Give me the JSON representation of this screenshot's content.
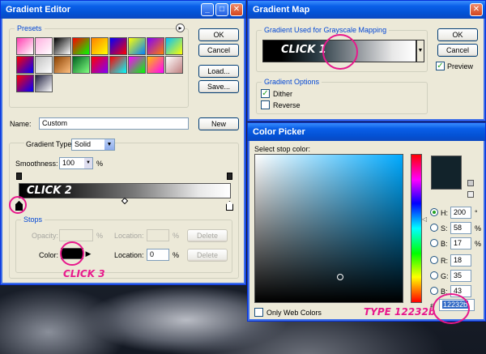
{
  "gradient_editor": {
    "title": "Gradient Editor",
    "presets_label": "Presets",
    "buttons": {
      "ok": "OK",
      "cancel": "Cancel",
      "load": "Load...",
      "save": "Save...",
      "new": "New"
    },
    "name_label": "Name:",
    "name_value": "Custom",
    "gradient_type_label": "Gradient Type:",
    "gradient_type_value": "Solid",
    "smoothness_label": "Smoothness:",
    "smoothness_value": "100",
    "smoothness_unit": "%",
    "stops_label": "Stops",
    "opacity_label": "Opacity:",
    "opacity_unit": "%",
    "location_label": "Location:",
    "location_unit": "%",
    "delete_label": "Delete",
    "color_label": "Color:",
    "location_value": "0",
    "swatch_colors": [
      "#ff3fb0,#ffffff",
      "#ffb0e0,#ffffff",
      "#000000,#ffffff",
      "#ff0000,#00ff00",
      "#ff8000,#ffff00",
      "#0000ff,#ff0000",
      "#ffff00,#0080ff",
      "#8000ff,#ff8000",
      "#00c0ff,#ffff00",
      "#ff0000,#0000ff",
      "#c0c0c0,#ffffff",
      "#8a4000,#ffc080",
      "#006020,#80ff80",
      "#ff0000,#8000ff",
      "#ff0000,#00ffff",
      "#ff00ff,#00ff00",
      "#ffc000,#ff00ff",
      "#ffffff,#c08080",
      "#ff0000,#0000ff",
      "#202040,#ffffff"
    ]
  },
  "gradient_map": {
    "title": "Gradient Map",
    "group_label": "Gradient Used for Grayscale Mapping",
    "options_label": "Gradient Options",
    "dither_label": "Dither",
    "reverse_label": "Reverse",
    "ok": "OK",
    "cancel": "Cancel",
    "preview_label": "Preview"
  },
  "color_picker": {
    "title": "Color Picker",
    "select_label": "Select stop color:",
    "only_web_label": "Only Web Colors",
    "fields": [
      {
        "label": "H:",
        "value": "200",
        "unit": "°"
      },
      {
        "label": "S:",
        "value": "58",
        "unit": "%"
      },
      {
        "label": "B:",
        "value": "17",
        "unit": "%"
      },
      {
        "label": "R:",
        "value": "18",
        "unit": ""
      },
      {
        "label": "G:",
        "value": "35",
        "unit": ""
      },
      {
        "label": "B:",
        "value": "43",
        "unit": ""
      }
    ],
    "hex_label": "#",
    "hex_value": "12232b",
    "current_color": "#12232b"
  },
  "annotations": {
    "click1": "CLICK 1",
    "click2": "CLICK 2",
    "click3": "CLICK 3",
    "type_hex": "TYPE 12232b"
  },
  "colors": {
    "annotation_pink": "#e8188c",
    "titlebar_blue": "#0452d4"
  }
}
